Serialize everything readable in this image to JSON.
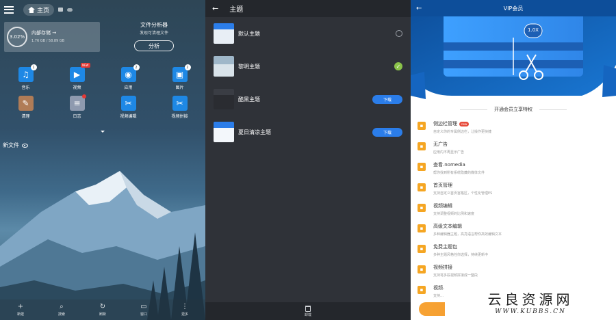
{
  "panel1": {
    "breadcrumb": "主页",
    "storage": {
      "percent": "3.02%",
      "title": "内部存储 →",
      "detail": "1.76 GB / 58.89 GB"
    },
    "analyzer": {
      "title": "文件分析器",
      "subtitle": "发现可清理文件",
      "button": "分析"
    },
    "categories": [
      {
        "label": "音乐",
        "icon": "music-icon",
        "color": "#1e88e5",
        "glyph": "♫",
        "badge": "1"
      },
      {
        "label": "视频",
        "icon": "video-icon",
        "color": "#1e88e5",
        "glyph": "▶",
        "badge": "NEW"
      },
      {
        "label": "应用",
        "icon": "android-icon",
        "color": "#1e88e5",
        "glyph": "◉",
        "badge": "2"
      },
      {
        "label": "图片",
        "icon": "image-icon",
        "color": "#1e88e5",
        "glyph": "▣",
        "badge": "2"
      },
      {
        "label": "清理",
        "icon": "broom-icon",
        "color": "#b07c57",
        "glyph": "✎",
        "badge": ""
      },
      {
        "label": "日志",
        "icon": "log-icon",
        "color": "#8e9aaf",
        "glyph": "≡",
        "badge": "dot"
      },
      {
        "label": "视频编辑",
        "icon": "video-edit-icon",
        "color": "#1e88e5",
        "glyph": "✂",
        "badge": ""
      },
      {
        "label": "视频拼接",
        "icon": "video-merge-icon",
        "color": "#1e88e5",
        "glyph": "✂",
        "badge": ""
      }
    ],
    "new_files": "新文件",
    "bottom_nav": [
      {
        "label": "新建",
        "icon": "plus-icon",
        "glyph": "+"
      },
      {
        "label": "搜索",
        "icon": "search-icon",
        "glyph": "⌕"
      },
      {
        "label": "刷新",
        "icon": "refresh-icon",
        "glyph": "↻"
      },
      {
        "label": "窗口",
        "icon": "window-icon",
        "glyph": "▭"
      },
      {
        "label": "更多",
        "icon": "more-icon",
        "glyph": "⋮"
      }
    ]
  },
  "panel2": {
    "title": "主题",
    "themes": [
      {
        "name": "默认主题",
        "state": "radio-off",
        "style": "light"
      },
      {
        "name": "黎明主题",
        "state": "radio-on",
        "style": "dawn"
      },
      {
        "name": "酷黑主题",
        "state": "download",
        "style": "dark"
      },
      {
        "name": "夏日清凉主题",
        "state": "download",
        "style": "summer"
      }
    ],
    "download_label": "下载",
    "uninstall_label": "卸载"
  },
  "panel3": {
    "title": "VIP会员",
    "banner_speed": "1.0X",
    "section_title": "开通会员立享特权",
    "new_tag": "new",
    "benefits": [
      {
        "title": "侧边栏管理",
        "desc": "自定义你的专属侧边栏，让操作更快捷",
        "new": true
      },
      {
        "title": "无广告",
        "desc": "应用内不再显示广告",
        "new": false
      },
      {
        "title": "查看.nomedia",
        "desc": "帮你找到所有系统隐藏的媒体文件",
        "new": false
      },
      {
        "title": "首页管理",
        "desc": "支持自定义首页宫格区，个性化管理ES",
        "new": false
      },
      {
        "title": "视频编辑",
        "desc": "支持调整视频的比例和速度",
        "new": false
      },
      {
        "title": "高级文本编辑",
        "desc": "多种编辑器主题，高亮语言帮你高效编辑文本",
        "new": false
      },
      {
        "title": "免费主题包",
        "desc": "多种主题风格任你选择，持续更新中",
        "new": false
      },
      {
        "title": "视频拼接",
        "desc": "支持将多段视频拼接成一整段",
        "new": false
      },
      {
        "title": "视频…",
        "desc": "支持…",
        "new": false
      }
    ]
  },
  "watermark": {
    "main": "云良资源网",
    "sub": "WWW.KUBBS.CN"
  }
}
